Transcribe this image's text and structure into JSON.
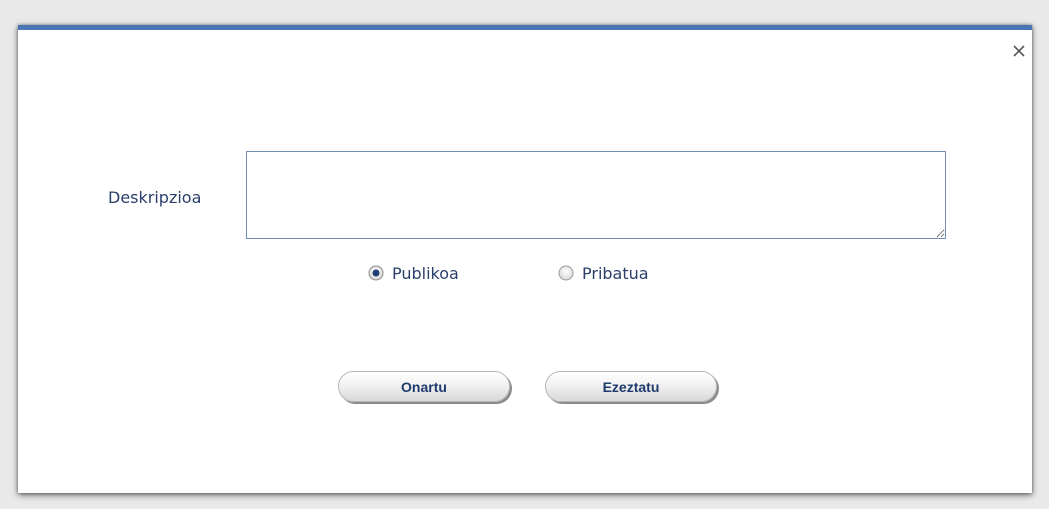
{
  "dialog": {
    "accent_color": "#4a75b5",
    "close_icon": "close-icon",
    "description": {
      "label": "Deskripzioa",
      "value": "",
      "placeholder": ""
    },
    "visibility": {
      "options": [
        {
          "label": "Publikoa",
          "selected": true
        },
        {
          "label": "Pribatua",
          "selected": false
        }
      ]
    },
    "buttons": {
      "accept_label": "Onartu",
      "cancel_label": "Ezeztatu"
    }
  }
}
